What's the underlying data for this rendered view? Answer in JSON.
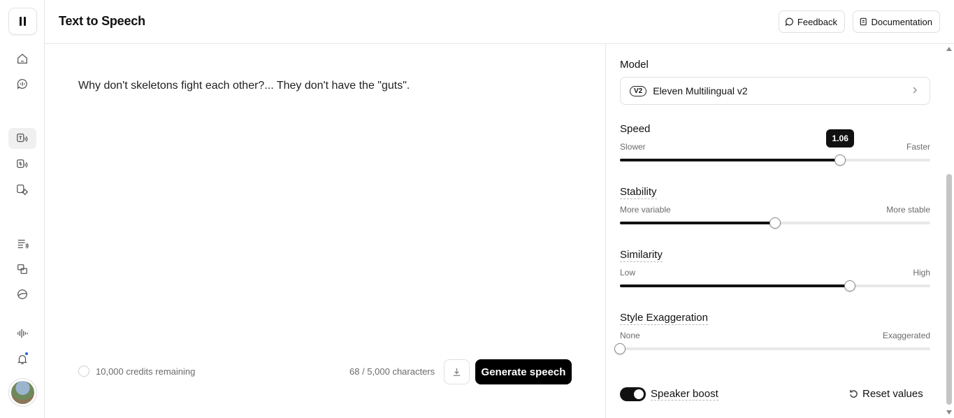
{
  "header": {
    "title": "Text to Speech",
    "feedback_label": "Feedback",
    "documentation_label": "Documentation"
  },
  "sidebar": {
    "items": [
      {
        "name": "home-icon"
      },
      {
        "name": "voices-icon"
      },
      {
        "name": "text-to-speech-icon",
        "active": true
      },
      {
        "name": "speech-to-speech-icon"
      },
      {
        "name": "sound-effects-icon"
      },
      {
        "name": "projects-icon"
      },
      {
        "name": "dubbing-icon"
      },
      {
        "name": "voice-lab-icon"
      },
      {
        "name": "audio-waveform-icon"
      },
      {
        "name": "notification-bell-icon",
        "unread": true
      }
    ]
  },
  "editor": {
    "text": "Why don't skeletons fight each other?... They don't have the \"guts\".",
    "credits": "10,000 credits remaining",
    "char_count": "68 / 5,000 characters",
    "generate_label": "Generate speech"
  },
  "settings": {
    "model": {
      "label": "Model",
      "badge": "V2",
      "value": "Eleven Multilingual v2"
    },
    "speed": {
      "label": "Speed",
      "min_label": "Slower",
      "max_label": "Faster",
      "value_label": "1.06",
      "fraction": 0.71
    },
    "stability": {
      "label": "Stability",
      "min_label": "More variable",
      "max_label": "More stable",
      "fraction": 0.5
    },
    "similarity": {
      "label": "Similarity",
      "min_label": "Low",
      "max_label": "High",
      "fraction": 0.74
    },
    "style": {
      "label": "Style Exaggeration",
      "min_label": "None",
      "max_label": "Exaggerated",
      "fraction": 0.0
    },
    "speaker_boost": {
      "label": "Speaker boost",
      "enabled": true
    },
    "reset_label": "Reset values"
  },
  "colors": {
    "accent": "#000000",
    "notification": "#2563eb"
  }
}
